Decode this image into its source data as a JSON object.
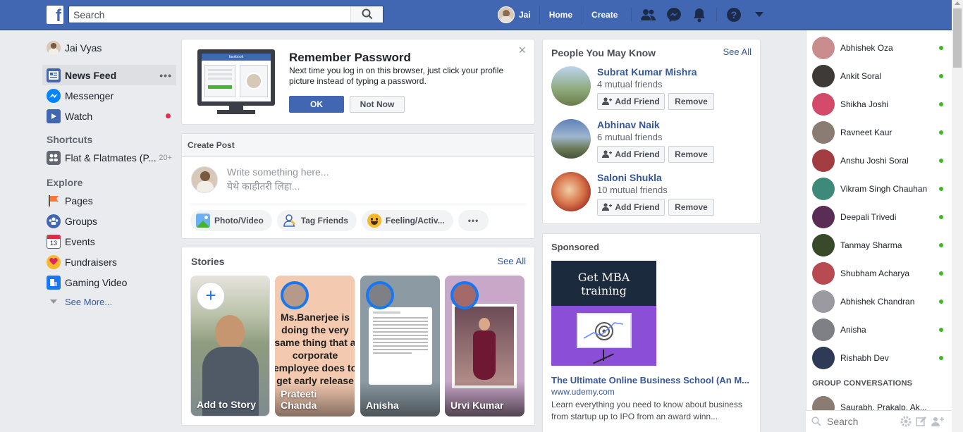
{
  "header": {
    "search_placeholder": "Search",
    "user_name": "Jai",
    "home": "Home",
    "create": "Create",
    "brand_color": "#4267b2"
  },
  "sidebar": {
    "profile": "Jai Vyas",
    "items": [
      {
        "label": "News Feed",
        "icon": "news-feed-icon",
        "more": "•••"
      },
      {
        "label": "Messenger",
        "icon": "messenger-icon"
      },
      {
        "label": "Watch",
        "icon": "watch-icon"
      }
    ],
    "shortcuts_title": "Shortcuts",
    "shortcuts": [
      {
        "label": "Flat & Flatmates (P...",
        "count": "20+"
      }
    ],
    "explore_title": "Explore",
    "explore": [
      {
        "label": "Pages",
        "icon": "pages-flag-icon"
      },
      {
        "label": "Groups",
        "icon": "groups-icon"
      },
      {
        "label": "Events",
        "icon": "calendar-icon",
        "day": "13"
      },
      {
        "label": "Fundraisers",
        "icon": "fundraiser-heart-icon"
      },
      {
        "label": "Gaming Video",
        "icon": "gaming-video-icon"
      }
    ],
    "see_more": "See More..."
  },
  "remember": {
    "title": "Remember Password",
    "body": "Next time you log in on this browser, just click your profile picture instead of typing a password.",
    "ok": "OK",
    "not_now": "Not Now",
    "close": "×",
    "preview_brand": "facebook"
  },
  "create_post": {
    "header": "Create Post",
    "placeholder_line1": "Write something here...",
    "placeholder_line2": "येथे काहीतरी लिहा...",
    "actions": [
      {
        "label": "Photo/Video",
        "icon": "photo-video-icon"
      },
      {
        "label": "Tag Friends",
        "icon": "tag-friends-icon"
      },
      {
        "label": "Feeling/Activ...",
        "icon": "feeling-emoji-icon"
      }
    ],
    "more": "•••"
  },
  "stories": {
    "title": "Stories",
    "see_all": "See All",
    "items": [
      {
        "name": "Add to Story",
        "plus": "+"
      },
      {
        "name": "Prateeti\nChanda",
        "text": "Ms.Banerjee is doing the very same thing that a corporate employee does to get early release while serving notice period 😜😆"
      },
      {
        "name": "Anisha"
      },
      {
        "name": "Urvi Kumar"
      }
    ]
  },
  "pymk": {
    "title": "People You May Know",
    "see_all": "See All",
    "add_friend": "Add Friend",
    "remove": "Remove",
    "people": [
      {
        "name": "Subrat Kumar Mishra",
        "mutual": "4 mutual friends"
      },
      {
        "name": "Abhinav Naik",
        "mutual": "6 mutual friends"
      },
      {
        "name": "Saloni Shukla",
        "mutual": "10 mutual friends"
      }
    ]
  },
  "sponsored": {
    "title": "Sponsored",
    "ad_line1": "Get MBA",
    "ad_line2": "training",
    "ad_title": "The Ultimate Online Business School (An M...",
    "ad_url": "www.udemy.com",
    "ad_body": "Learn everything you need to know about business from startup up to IPO from an award winn..."
  },
  "chat": {
    "contacts": [
      {
        "name": "Abhishek Oza",
        "color": "#c98d8d"
      },
      {
        "name": "Ankit Soral",
        "color": "#3d3a37"
      },
      {
        "name": "Shikha Joshi",
        "color": "#d44a6a"
      },
      {
        "name": "Ravneet Kaur",
        "color": "#8a7b73"
      },
      {
        "name": "Anshu Joshi Soral",
        "color": "#a23d42"
      },
      {
        "name": "Vikram Singh Chauhan",
        "color": "#3e8a7a"
      },
      {
        "name": "Deepali Trivedi",
        "color": "#5a2d56"
      },
      {
        "name": "Tanmay Sharma",
        "color": "#394a2a"
      },
      {
        "name": "Shubham Acharya",
        "color": "#b84a52"
      },
      {
        "name": "Abhishek Chandran",
        "color": "#9a9aa0"
      },
      {
        "name": "Anisha",
        "color": "#7f8086"
      },
      {
        "name": "Rishabh Dev",
        "color": "#2e3a56"
      }
    ],
    "group_title": "GROUP CONVERSATIONS",
    "group_item": "Saurabh, Prakalp, Ak...",
    "search_placeholder": "Search"
  }
}
